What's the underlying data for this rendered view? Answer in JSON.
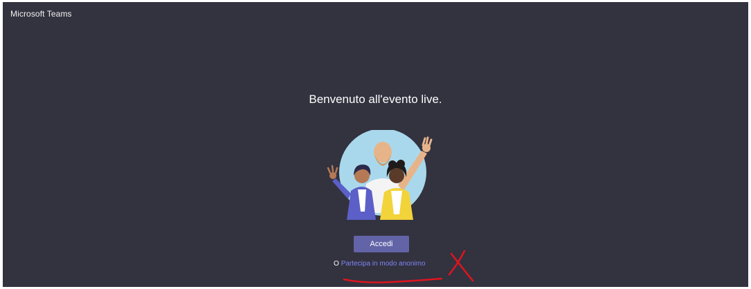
{
  "app": {
    "title": "Microsoft Teams"
  },
  "main": {
    "welcome_text": "Benvenuto all'evento live.",
    "signin_label": "Accedi",
    "or_text": "O",
    "anonymous_link": "Partecipa in modo anonimo"
  },
  "colors": {
    "background": "#33323f",
    "accent": "#6264a7",
    "link": "#7f85f5",
    "annotation": "#e0141e"
  },
  "illustration": {
    "icon": "people-waving-illustration"
  },
  "annotation": {
    "icons": [
      "red-underline-icon",
      "red-x-mark-icon"
    ]
  }
}
